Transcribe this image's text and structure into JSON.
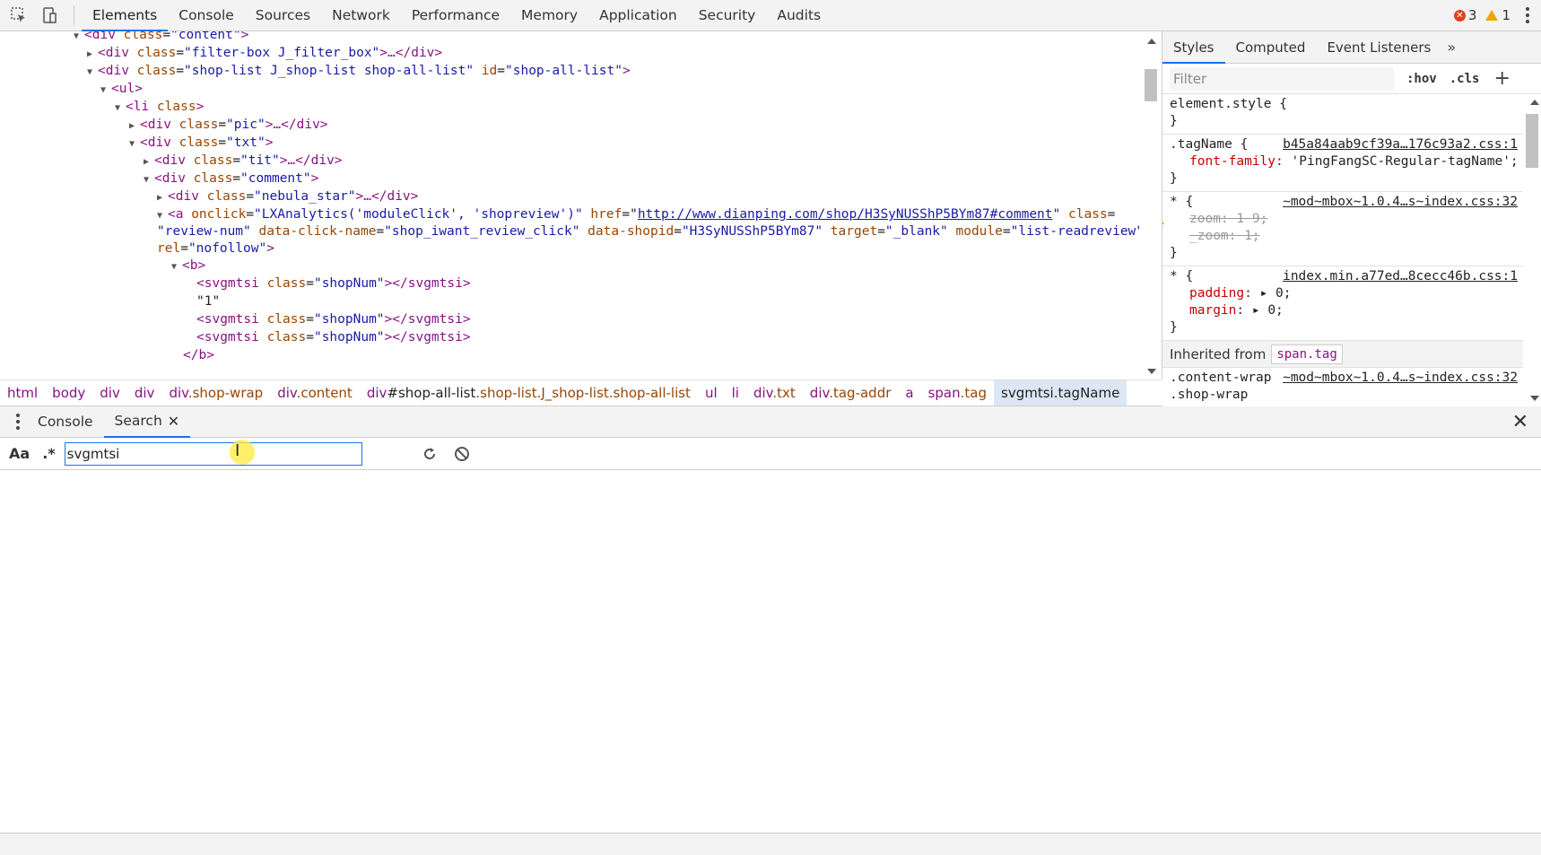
{
  "toolbar": {
    "tabs": [
      "Elements",
      "Console",
      "Sources",
      "Network",
      "Performance",
      "Memory",
      "Application",
      "Security",
      "Audits"
    ],
    "active_tab": "Elements",
    "error_count": "3",
    "warning_count": "1"
  },
  "dom_lines": [
    {
      "t": "&lt;div class=\"content\"&gt;"
    },
    {
      "t": "&lt;div class=\"filter-box J_filter_box\"&gt;…&lt;/div&gt;"
    },
    {
      "t": "&lt;div class=\"shop-list J_shop-list shop-all-list\" id=\"shop-all-list\"&gt;"
    },
    {
      "t": "&lt;ul&gt;"
    },
    {
      "t": "&lt;li class&gt;"
    },
    {
      "t": "&lt;div class=\"pic\"&gt;…&lt;/div&gt;"
    },
    {
      "t": "&lt;div class=\"txt\"&gt;"
    },
    {
      "t": "&lt;div class=\"tit\"&gt;…&lt;/div&gt;"
    },
    {
      "t": "&lt;div class=\"comment\"&gt;"
    },
    {
      "t": "&lt;div class=\"nebula_star\"&gt;…&lt;/div&gt;"
    },
    {
      "t": "&lt;a onclick=\"LXAnalytics('moduleClick', 'shopreview')\" href=\"http://www.dianping.com/shop/H3SyNUSShP5BYm87#comment\" class="
    },
    {
      "t": "\"review-num\" data-click-name=\"shop_iwant_review_click\" data-shopid=\"H3SyNUSShP5BYm87\" target=\"_blank\" module=\"list-readreview\""
    },
    {
      "t": "rel=\"nofollow\"&gt;"
    },
    {
      "t": "&lt;b&gt;"
    },
    {
      "t": "&lt;svgmtsi class=\"shopNum\"&gt;&lt;/svgmtsi&gt;"
    },
    {
      "t": "\"1\""
    },
    {
      "t": "&lt;svgmtsi class=\"shopNum\"&gt;&lt;/svgmtsi&gt;"
    },
    {
      "t": "&lt;svgmtsi class=\"shopNum\"&gt;&lt;/svgmtsi&gt;"
    },
    {
      "t": "&lt;/b&gt;"
    }
  ],
  "dom": {
    "l0_tag": "<div",
    "l0_an": " class",
    "l0_av": "\"content\"",
    "l0_end": ">",
    "l1_tag": "<div",
    "l1_an": " class",
    "l1_av": "\"filter-box J_filter_box\"",
    "l1_end": ">…</div>",
    "l2_tag": "<div",
    "l2_an1": " class",
    "l2_av1": "\"shop-list J_shop-list shop-all-list\"",
    "l2_an2": " id",
    "l2_av2": "\"shop-all-list\"",
    "l2_end": ">",
    "l3_tag": "<ul>",
    "l4_tag": "<li",
    "l4_an": " class",
    "l4_end": ">",
    "l5_tag": "<div",
    "l5_an": " class",
    "l5_av": "\"pic\"",
    "l5_end": ">…</div>",
    "l6_tag": "<div",
    "l6_an": " class",
    "l6_av": "\"txt\"",
    "l6_end": ">",
    "l7_tag": "<div",
    "l7_an": " class",
    "l7_av": "\"tit\"",
    "l7_end": ">…</div>",
    "l8_tag": "<div",
    "l8_an": " class",
    "l8_av": "\"comment\"",
    "l8_end": ">",
    "l9_tag": "<div",
    "l9_an": " class",
    "l9_av": "\"nebula_star\"",
    "l9_end": ">…</div>",
    "l10_tag": "<a",
    "l10_an1": " onclick",
    "l10_av1": "\"LXAnalytics('moduleClick', 'shopreview')\"",
    "l10_an2": " href",
    "l10_link": "http://www.dianping.com/shop/H3SyNUSShP5BYm87#comment",
    "l10_an3": " class",
    "l11_av1": "\"review-num\"",
    "l11_an2": " data-click-name",
    "l11_av2": "\"shop_iwant_review_click\"",
    "l11_an3": " data-shopid",
    "l11_av3": "\"H3SyNUSShP5BYm87\"",
    "l11_an4": " target",
    "l11_av4": "\"_blank\"",
    "l11_an5": " module",
    "l11_av5": "\"list-readreview\"",
    "l12_an": "rel",
    "l12_av": "\"nofollow\"",
    "l12_end": ">",
    "l13_tag": "<b>",
    "svg_open": "<svgmtsi",
    "svg_an": " class",
    "svg_av": "\"shopNum\"",
    "svg_end": "></svgmtsi>",
    "svg_glyph": "",
    "l15_text": "\"1\"",
    "l18_tag": "</b>"
  },
  "breadcrumbs": {
    "c0": "html",
    "c1": "body",
    "c2": "div",
    "c3": "div",
    "c4_tag": "div",
    "c4_cls": ".shop-wrap",
    "c5_tag": "div",
    "c5_cls": ".content",
    "c6_tag": "div",
    "c6_id": "#shop-all-list",
    "c6_cls": ".shop-list.J_shop-list.shop-all-list",
    "c7": "ul",
    "c8": "li",
    "c9_tag": "div",
    "c9_cls": ".txt",
    "c10_tag": "div",
    "c10_cls": ".tag-addr",
    "c11": "a",
    "c12_tag": "span",
    "c12_cls": ".tag",
    "c13": "svgmtsi.tagName"
  },
  "styles": {
    "tabs": [
      "Styles",
      "Computed",
      "Event Listeners"
    ],
    "filter_placeholder": "Filter",
    "hov": ":hov",
    "cls": ".cls",
    "r0_sel": "element.style {",
    "r0_close": "}",
    "r1_sel": ".tagName {",
    "r1_src": "b45a84aab9cf39a…176c93a2.css:1",
    "r1_pn": "font-family",
    "r1_pv": "'PingFangSC-Regular-tagName';",
    "r1_close": "}",
    "r2_sel": "* {",
    "r2_src": "~mod~mbox~1.0.4…s~index.css:32",
    "r2_p1n": "zoom",
    "r2_p1v": "1 9;",
    "r2_p2n": "_zoom",
    "r2_p2v": "1;",
    "r2_close": "}",
    "r3_sel": "* {",
    "r3_src": "index.min.a77ed…8cecc46b.css:1",
    "r3_p1n": "padding",
    "r3_p1v": "0;",
    "r3_p2n": "margin",
    "r3_p2v": "0;",
    "r3_close": "}",
    "inherited_label": "Inherited from",
    "inherited_tag": "span.tag",
    "r4_sel1": ".content-wrap",
    "r4_sel2": ".shop-wrap",
    "r4_src": "~mod~mbox~1.0.4…s~index.css:32"
  },
  "drawer": {
    "tabs": [
      "Console",
      "Search"
    ],
    "active_tab": "Search"
  },
  "search": {
    "aa": "Aa",
    "regex": ".*",
    "query": "svgmtsi"
  },
  "colors": {
    "accent": "#1a73e8",
    "error": "#e0401c",
    "warning": "#f2a600",
    "tag": "#881280",
    "attr_name": "#994500",
    "attr_value": "#1a1aa6"
  }
}
